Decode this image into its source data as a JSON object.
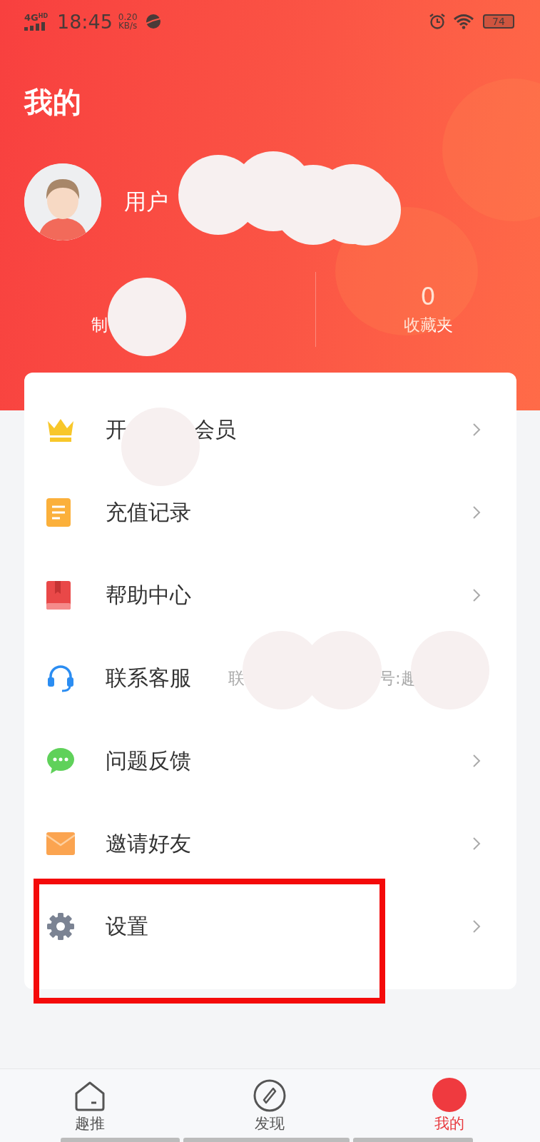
{
  "status_bar": {
    "network": "4G",
    "network_badge": "HD",
    "time": "18:45",
    "speed_value": "0.20",
    "speed_unit": "KB/s",
    "battery": "74"
  },
  "page_title": "我的",
  "profile": {
    "username": "用户"
  },
  "stats": [
    {
      "label": "制"
    },
    {
      "value": "0",
      "label": "收藏夹"
    }
  ],
  "menu": [
    {
      "label_parts": [
        "开",
        "会员"
      ],
      "kind": "crown",
      "chevron": true,
      "highlighted": false
    },
    {
      "label_parts": [
        "充值记录"
      ],
      "kind": "note",
      "chevron": true,
      "highlighted": false
    },
    {
      "label_parts": [
        "帮助中心"
      ],
      "kind": "book",
      "chevron": true,
      "highlighted": false
    },
    {
      "label_parts": [
        "联系客服"
      ],
      "note_parts": [
        "联",
        "号:趣"
      ],
      "kind": "headset",
      "chevron": false,
      "highlighted": false
    },
    {
      "label_parts": [
        "问题反馈"
      ],
      "kind": "chat",
      "chevron": true,
      "highlighted": false
    },
    {
      "label_parts": [
        "邀请好友"
      ],
      "kind": "mail",
      "chevron": true,
      "highlighted": false
    },
    {
      "label_parts": [
        "设置"
      ],
      "kind": "gear",
      "chevron": true,
      "highlighted": true
    }
  ],
  "tabs": [
    {
      "label": "趣推",
      "kind": "home",
      "selected": false
    },
    {
      "label": "发现",
      "kind": "compass",
      "selected": false
    },
    {
      "label": "我的",
      "kind": "avatar",
      "selected": true
    }
  ]
}
